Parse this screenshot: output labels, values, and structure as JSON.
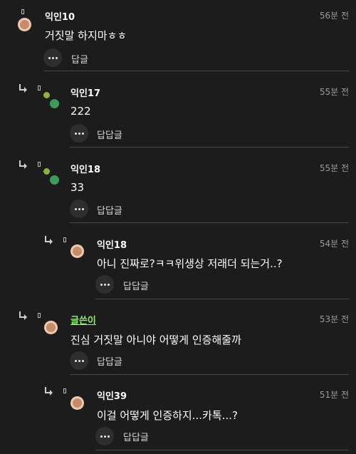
{
  "comments": [
    {
      "author": "익인10",
      "time": "56분 전",
      "text": "거짓말 하지마ㅎㅎ",
      "reply_label": "답글",
      "is_op": false
    },
    {
      "author": "익인17",
      "time": "55분 전",
      "text": "222",
      "reply_label": "답답글",
      "is_op": false
    },
    {
      "author": "익인18",
      "time": "55분 전",
      "text": "33",
      "reply_label": "답답글",
      "is_op": false
    },
    {
      "author": "익인18",
      "time": "54분 전",
      "text": "아니 진짜로?ㅋㅋ위생상 저래더 되는거..?",
      "reply_label": "답답글",
      "is_op": false
    },
    {
      "author": "글쓴이",
      "time": "53분 전",
      "text": "진심 거짓말 아니야 어떻게 인증해줄까",
      "reply_label": "답답글",
      "is_op": true
    },
    {
      "author": "익인39",
      "time": "51분 전",
      "text": "이걸 어떻게 인증하지...카톡...?",
      "reply_label": "답답글",
      "is_op": false
    }
  ],
  "colors": {
    "background": "#1c1c1c",
    "op_name": "#8ff06a",
    "time": "#9a9a9a",
    "divider": "#4a4a4a"
  },
  "icons": [
    "reply-arrow-icon",
    "bookmark-icon",
    "more-icon"
  ]
}
